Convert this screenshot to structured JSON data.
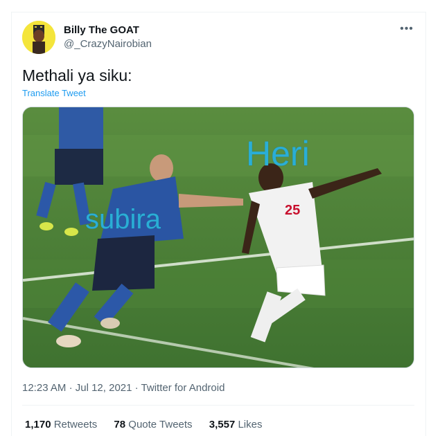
{
  "author": {
    "name": "Billy The GOAT",
    "handle": "@_CrazyNairobian"
  },
  "tweet": {
    "text": "Methali ya siku:",
    "translate_label": "Translate Tweet"
  },
  "media": {
    "overlay_words": [
      "Heri",
      "subira"
    ],
    "jersey_number": "25",
    "overlay_color": "#2aaed6"
  },
  "meta": {
    "time": "12:23 AM",
    "date": "Jul 12, 2021",
    "source": "Twitter for Android"
  },
  "stats": {
    "retweets_count": "1,170",
    "retweets_label": "Retweets",
    "quotes_count": "78",
    "quotes_label": "Quote Tweets",
    "likes_count": "3,557",
    "likes_label": "Likes"
  },
  "icons": {
    "more": "more-options-icon"
  },
  "colors": {
    "link": "#1d9bf0",
    "secondary_text": "#536471",
    "primary_text": "#0f1419"
  }
}
